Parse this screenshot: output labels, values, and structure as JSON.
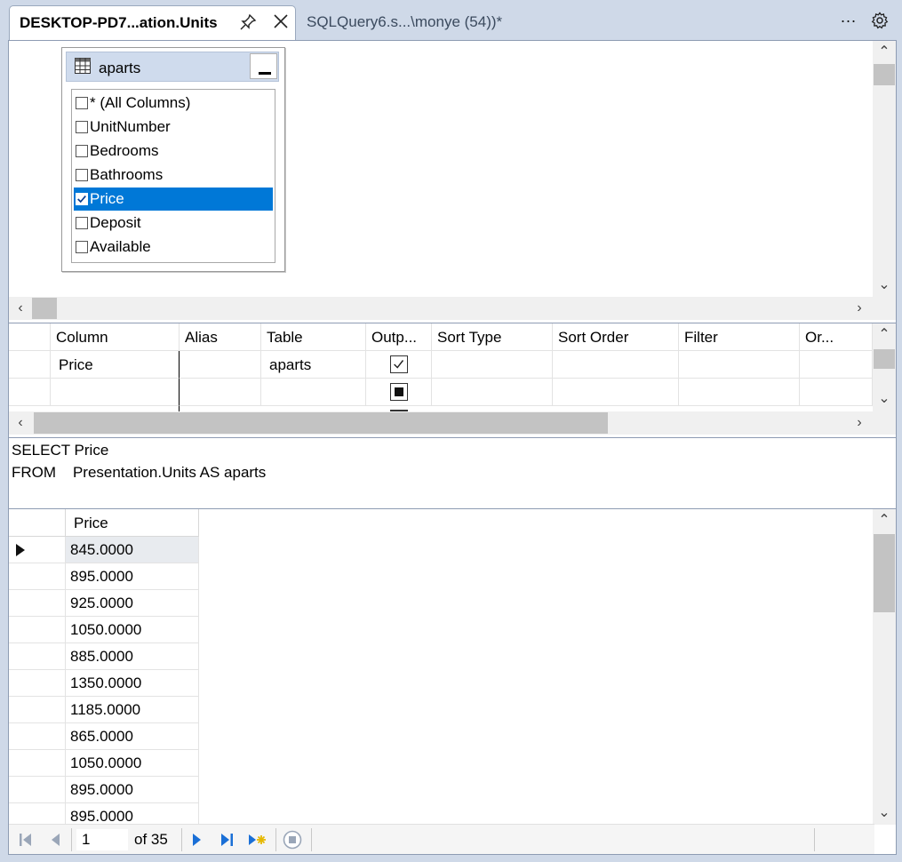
{
  "tabs": {
    "active_label": "DESKTOP-PD7...ation.Units",
    "inactive_label": "SQLQuery6.s...\\monye (54))*",
    "more_label": "..."
  },
  "diagram": {
    "table_name": "aparts",
    "columns": [
      {
        "label": "* (All Columns)",
        "checked": false
      },
      {
        "label": "UnitNumber",
        "checked": false
      },
      {
        "label": "Bedrooms",
        "checked": false
      },
      {
        "label": "Bathrooms",
        "checked": false
      },
      {
        "label": "Price",
        "checked": true,
        "selected": true
      },
      {
        "label": "Deposit",
        "checked": false
      },
      {
        "label": "Available",
        "checked": false
      }
    ]
  },
  "grid": {
    "headers": [
      "Column",
      "Alias",
      "Table",
      "Outp...",
      "Sort Type",
      "Sort Order",
      "Filter",
      "Or..."
    ],
    "rows": [
      {
        "column": "Price",
        "alias": "",
        "table": "aparts",
        "output": "checked"
      }
    ]
  },
  "sql": {
    "line1": "SELECT Price",
    "line2": "FROM    Presentation.Units AS aparts"
  },
  "results": {
    "header": "Price",
    "values": [
      "845.0000",
      "895.0000",
      "925.0000",
      "1050.0000",
      "885.0000",
      "1350.0000",
      "1185.0000",
      "865.0000",
      "1050.0000",
      "895.0000",
      "895.0000"
    ]
  },
  "navigation": {
    "current_page": "1",
    "of_label": "of 35"
  },
  "colors": {
    "accent": "#0078d7",
    "chrome": "#cfd9e8",
    "nav_blue": "#1a6fd6"
  }
}
